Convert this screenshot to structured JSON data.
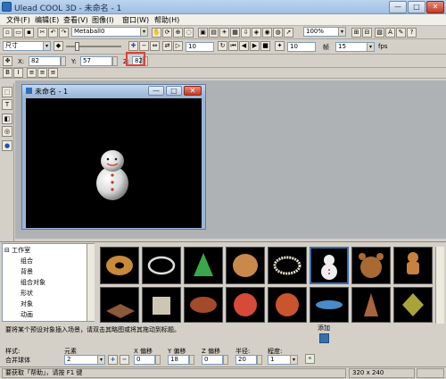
{
  "window": {
    "title": "Ulead COOL 3D - 未命名 - 1",
    "min": "—",
    "max": "□",
    "close": "✕"
  },
  "menu": [
    "文件(F)",
    "编辑(E)",
    "查看(V)",
    "图像(I)",
    "窗口(W)",
    "帮助(H)"
  ],
  "toolbar1": {
    "font_combo": "Metaball0",
    "zoom_combo": "100%"
  },
  "toolbar2": {
    "size_combo": "尺寸",
    "frame_value": "10",
    "frame_count": "10",
    "fps_value": "15",
    "fps_label": "fps",
    "frames_label": "帧"
  },
  "coords": {
    "x_label": "X:",
    "x_value": "82",
    "y_label": "Y:",
    "y_value": "57",
    "z_label": "Z:",
    "z_value": "82"
  },
  "doc": {
    "title": "未命名 - 1"
  },
  "tree": {
    "root": "工作室",
    "items": [
      "组合",
      "背景",
      "组合对象",
      "形状",
      "对象",
      "动画"
    ]
  },
  "thumbs_row1": [
    "donut",
    "ring",
    "cone",
    "shell",
    "pearls",
    "snowman",
    "bear",
    "gingerbread"
  ],
  "thumbs_row2": [
    "slab",
    "box",
    "football",
    "sphere",
    "ball",
    "spinner",
    "spiral",
    "spintop"
  ],
  "hint": "要将某个预设对象插入场景，请双击其略图或将其拖动到标题。",
  "add": {
    "label": "添加"
  },
  "props": {
    "style_label": "样式:",
    "style_value": "合并球体",
    "element_label": "元素",
    "element_value": "2",
    "x_offset_label": "X 偏移",
    "x_offset_value": "0",
    "y_offset_label": "Y 偏移",
    "y_offset_value": "18",
    "z_offset_label": "Z 偏移",
    "z_offset_value": "0",
    "radius_label": "半径:",
    "radius_value": "20",
    "degree_label": "程度:",
    "degree_value": "1"
  },
  "status": {
    "help": "要获取「帮助」，请按 F1 键",
    "size": "320 x 240"
  },
  "colors": {
    "accent": "#3b6ea8",
    "highlight": "#e04040"
  }
}
